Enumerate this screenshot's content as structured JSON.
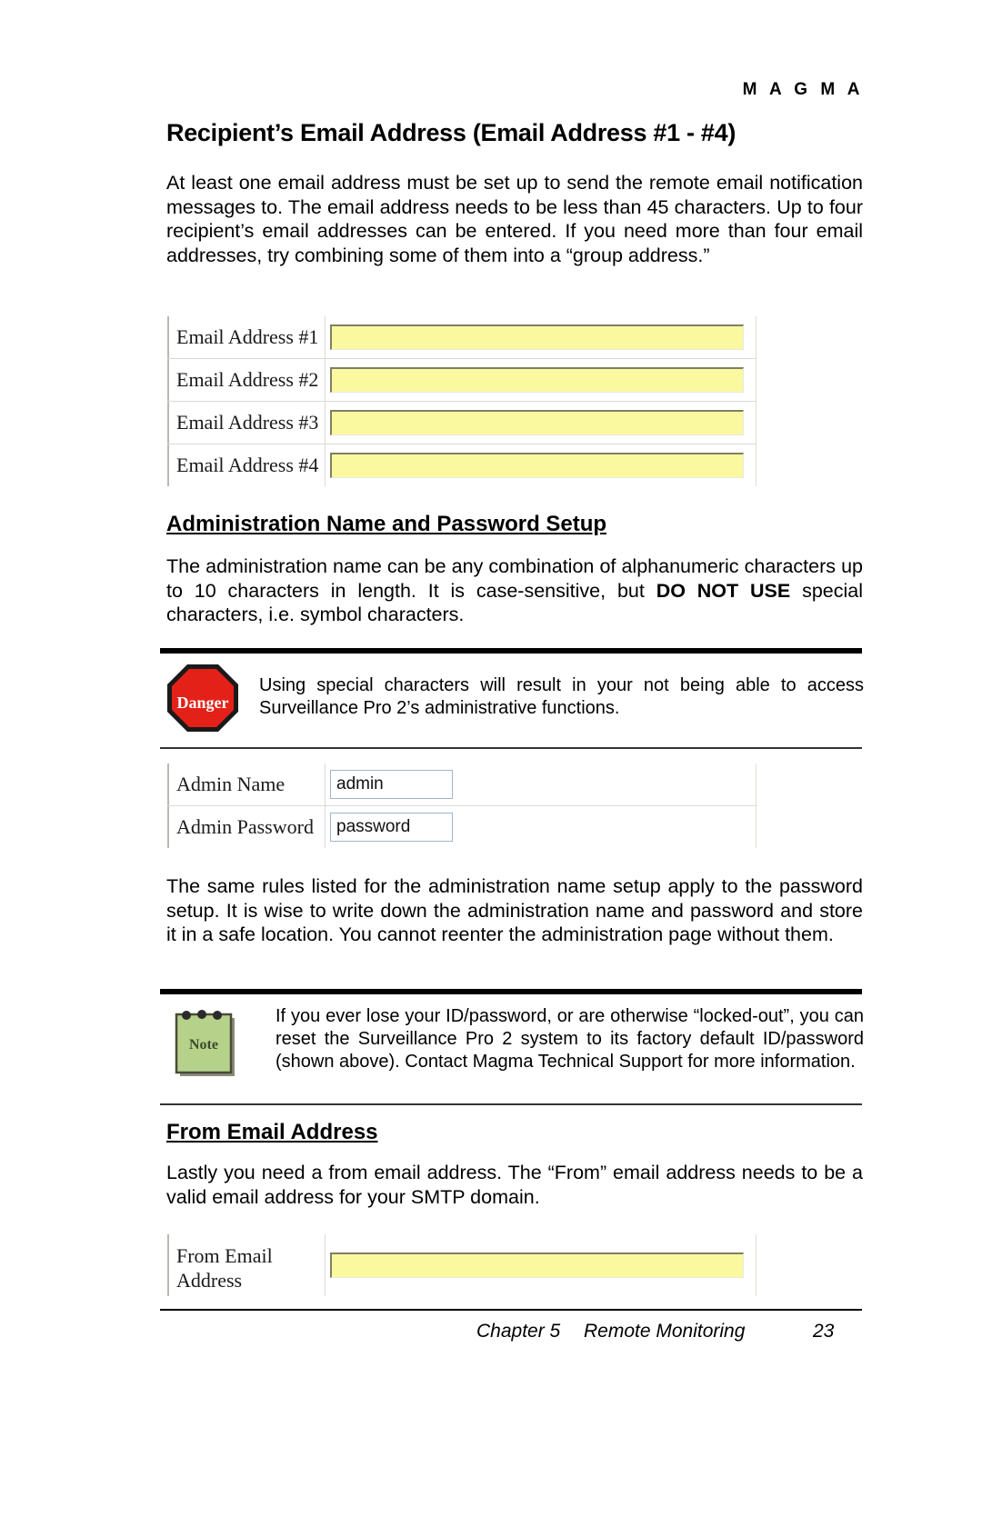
{
  "header": {
    "brand": "M A G M A"
  },
  "sections": {
    "recipient": {
      "title": "Recipient’s Email Address (Email Address #1 - #4)",
      "paragraph": "At least one email address must be set up to send the remote email notification messages to. The email address needs to be less than 45 characters. Up to four recipient’s email addresses can be entered. If you need more than four email addresses, try combining some of them into a “group address.”"
    },
    "admin": {
      "title": "Administration Name and Password Setup",
      "paragraph_pre": "The administration name can be any combination of alphanumeric characters up to 10 characters in length. It is case-sensitive, but ",
      "paragraph_bold": "DO NOT USE",
      "paragraph_post": " special characters, i.e. symbol characters.",
      "paragraph_after": "The same rules listed for the administration name setup apply to the password setup. It is wise to write down the administration name and password and store it in a safe location. You cannot reenter the administration page without them."
    },
    "from_email": {
      "title": "From Email Address",
      "paragraph": "Lastly you need a from email address. The “From” email address needs to be a valid email address for your SMTP domain."
    }
  },
  "callouts": {
    "danger": {
      "icon_label": "Danger",
      "text": "Using special characters will result in your not being able to access Surveillance Pro 2’s administrative functions."
    },
    "note": {
      "icon_label": "Note",
      "text": "If you ever lose your ID/password, or are otherwise “locked-out”, you can reset the Surveillance Pro 2 system to its factory default ID/password (shown above). Contact Magma Technical Support for more information."
    }
  },
  "email_form": {
    "rows": [
      {
        "label": "Email Address #1",
        "value": ""
      },
      {
        "label": "Email Address #2",
        "value": ""
      },
      {
        "label": "Email Address #3",
        "value": ""
      },
      {
        "label": "Email Address #4",
        "value": ""
      }
    ]
  },
  "admin_form": {
    "rows": [
      {
        "label": "Admin Name",
        "value": "admin"
      },
      {
        "label": "Admin Password",
        "value": "password"
      }
    ]
  },
  "from_form": {
    "rows": [
      {
        "label_line1": "From Email",
        "label_line2": "Address",
        "value": ""
      }
    ]
  },
  "footer": {
    "chapter": "Chapter 5",
    "section": "Remote Monitoring",
    "page_number": "23"
  },
  "colors": {
    "input_yellow": "#fbf9a0",
    "danger_red": "#e32119",
    "note_green": "#b5d18a",
    "text": "#000000"
  }
}
